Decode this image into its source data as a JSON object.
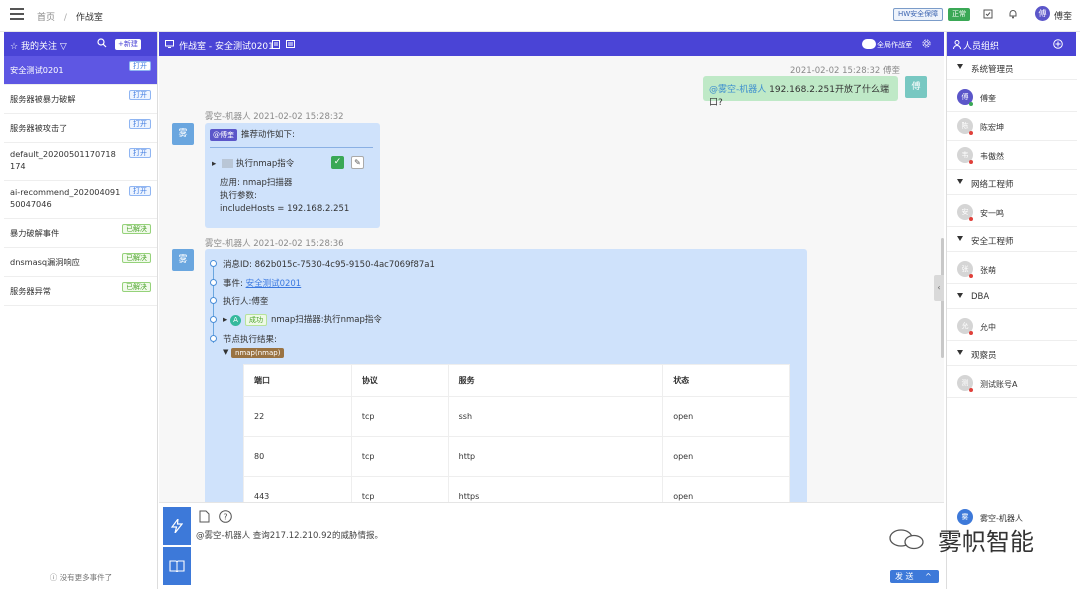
{
  "topbar": {
    "breadcrumb": [
      "首页",
      "作战室"
    ],
    "hw_badge": "HW安全保障",
    "status_badge": "正常",
    "avatar_char": "傅",
    "username": "傅奎"
  },
  "left": {
    "title": "我的关注",
    "new_btn": "+新建",
    "events": [
      {
        "name": "安全测试0201",
        "status": "打开",
        "type": "open"
      },
      {
        "name": "服务器被暴力破解",
        "status": "打开",
        "type": "open"
      },
      {
        "name": "服务器被攻击了",
        "status": "打开",
        "type": "open"
      },
      {
        "name": "default_20200501170718174",
        "status": "打开",
        "type": "open"
      },
      {
        "name": "ai-recommend_20200409150047046",
        "status": "打开",
        "type": "open"
      },
      {
        "name": "暴力破解事件",
        "status": "已解决",
        "type": "done"
      },
      {
        "name": "dnsmasq漏洞响应",
        "status": "已解决",
        "type": "done"
      },
      {
        "name": "服务器异常",
        "status": "已解决",
        "type": "done"
      }
    ],
    "footer": "没有更多事件了"
  },
  "center": {
    "title": "作战室 - 安全测试0201",
    "global_label": "全局作战室",
    "msg1": {
      "meta": "2021-02-02 15:28:32 傅奎",
      "mention": "@雾空-机器人",
      "text": " 192.168.2.251开放了什么端口?",
      "avatar": "傅"
    },
    "msg2": {
      "meta": "雾空-机器人 2021-02-02 15:28:32",
      "avatar": "雾",
      "at": "@傅奎",
      "title": "推荐动作如下:",
      "action": "执行nmap指令",
      "app": "应用: nmap扫描器",
      "params": "执行参数:",
      "param_val": "includeHosts = 192.168.2.251"
    },
    "msg3": {
      "meta": "雾空-机器人 2021-02-02 15:28:36",
      "avatar": "雾",
      "msg_id": "消息ID: 862b015c-7530-4c95-9150-4ac7069f87a1",
      "event_label": "事件: ",
      "event_link": "安全测试0201",
      "executor": "执行人:傅奎",
      "success_a": "A",
      "success_lbl": "成功",
      "step": "nmap扫描器:执行nmap指令",
      "result_label": "节点执行结果:",
      "nmap_tag": "nmap(nmap)",
      "table": {
        "headers": [
          "端口",
          "协议",
          "服务",
          "状态"
        ],
        "rows": [
          [
            "22",
            "tcp",
            "ssh",
            "open"
          ],
          [
            "80",
            "tcp",
            "http",
            "open"
          ],
          [
            "443",
            "tcp",
            "https",
            "open"
          ]
        ]
      }
    },
    "input_text": "@雾空-机器人 查询217.12.210.92的威胁情报。",
    "send": "发 送"
  },
  "right": {
    "title": "人员组织",
    "groups": [
      {
        "name": "系统管理员",
        "members": [
          {
            "name": "傅奎",
            "av": "傅",
            "online": true
          },
          {
            "name": "陈宏坤",
            "av": "陈",
            "online": false
          },
          {
            "name": "韦傲然",
            "av": "韦",
            "online": false
          }
        ]
      },
      {
        "name": "网络工程师",
        "members": [
          {
            "name": "安一鸣",
            "av": "安",
            "online": false
          }
        ]
      },
      {
        "name": "安全工程师",
        "members": [
          {
            "name": "张萌",
            "av": "张",
            "online": false
          }
        ]
      },
      {
        "name": "DBA",
        "members": [
          {
            "name": "允中",
            "av": "允",
            "online": false
          }
        ]
      },
      {
        "name": "观察员",
        "members": [
          {
            "name": "测试账号A",
            "av": "测",
            "online": false
          }
        ]
      }
    ],
    "bot": {
      "name": "雾空-机器人",
      "av": "雾"
    }
  },
  "watermark": "雾帜智能",
  "colors": {
    "primary": "#4a44d6",
    "bubble_me": "#bfe9c7",
    "bubble_bot": "#cfe2fb",
    "accent_blue": "#3d79d9"
  }
}
